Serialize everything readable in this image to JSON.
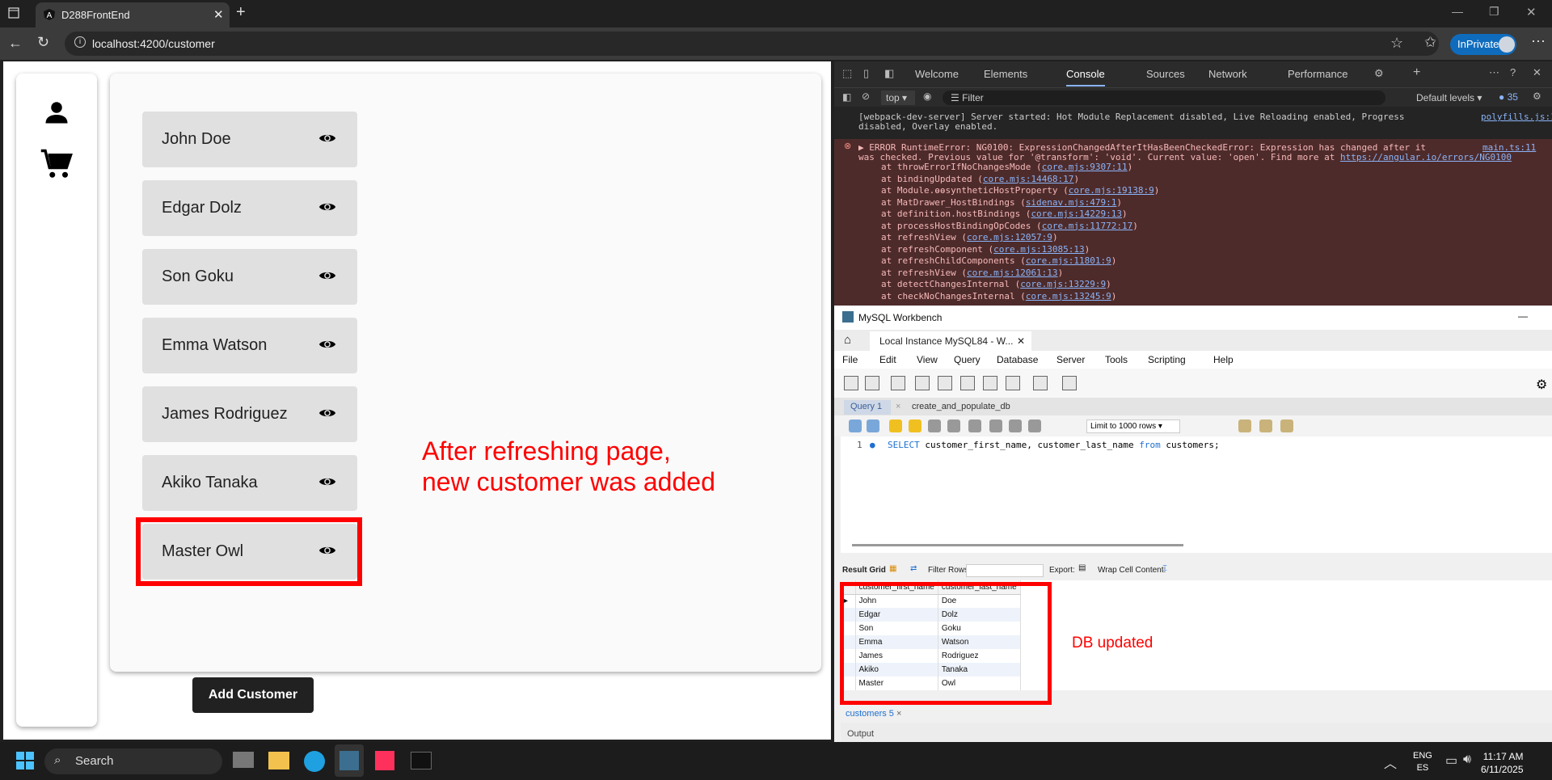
{
  "browser": {
    "tab_title": "D288FrontEnd",
    "url": "localhost:4200/customer",
    "inprivate_label": "InPrivate"
  },
  "app": {
    "customers": [
      {
        "name": "John Doe"
      },
      {
        "name": "Edgar Dolz"
      },
      {
        "name": "Son Goku"
      },
      {
        "name": "Emma Watson"
      },
      {
        "name": "James Rodriguez"
      },
      {
        "name": "Akiko Tanaka"
      },
      {
        "name": "Master Owl"
      }
    ],
    "add_button_label": "Add Customer",
    "annotation": "After refreshing page,\nnew customer was added"
  },
  "devtools": {
    "tabs": [
      "Welcome",
      "Elements",
      "Console",
      "Sources",
      "Network",
      "Performance"
    ],
    "active_tab": "Console",
    "context": "top",
    "filter_placeholder": "Filter",
    "levels": "Default levels",
    "issue_count": "35",
    "info_line_1": "[webpack-dev-server] Server started: Hot Module Replacement disabled, Live Reloading enabled, Progress",
    "info_line_2": "disabled, Overlay enabled.",
    "info_source": "polyfills.js:1",
    "error_line_1": "ERROR RuntimeError: NG0100: ExpressionChangedAfterItHasBeenCheckedError: Expression has changed after it",
    "error_line_2": "was checked. Previous value for '@transform': 'void'. Current value: 'open'. Find more at ",
    "error_link": "https://angular.io/errors/NG0100",
    "error_source": "main.ts:11",
    "stack": [
      {
        "fn": "at throwErrorIfNoChangesMode (",
        "loc": "core.mjs:9307:11"
      },
      {
        "fn": "at bindingUpdated (",
        "loc": "core.mjs:14468:17"
      },
      {
        "fn": "at Module.ɵɵsyntheticHostProperty (",
        "loc": "core.mjs:19138:9"
      },
      {
        "fn": "at MatDrawer_HostBindings (",
        "loc": "sidenav.mjs:479:1"
      },
      {
        "fn": "at definition.hostBindings (",
        "loc": "core.mjs:14229:13"
      },
      {
        "fn": "at processHostBindingOpCodes (",
        "loc": "core.mjs:11772:17"
      },
      {
        "fn": "at refreshView (",
        "loc": "core.mjs:12057:9"
      },
      {
        "fn": "at refreshComponent (",
        "loc": "core.mjs:13085:13"
      },
      {
        "fn": "at refreshChildComponents (",
        "loc": "core.mjs:11801:9"
      },
      {
        "fn": "at refreshView (",
        "loc": "core.mjs:12061:13"
      },
      {
        "fn": "at detectChangesInternal (",
        "loc": "core.mjs:13229:9"
      },
      {
        "fn": "at checkNoChangesInternal (",
        "loc": "core.mjs:13245:9"
      }
    ]
  },
  "workbench": {
    "title": "MySQL Workbench",
    "connection_tab": "Local Instance MySQL84 - W...",
    "menu": [
      "File",
      "Edit",
      "View",
      "Query",
      "Database",
      "Server",
      "Tools",
      "Scripting",
      "Help"
    ],
    "query_tabs": [
      "Query 1",
      "create_and_populate_db"
    ],
    "limit_label": "Limit to 1000 rows",
    "line_number": "1",
    "sql": {
      "kw1": "SELECT",
      "cols": " customer_first_name, customer_last_name ",
      "kw2": "from",
      "rest": " customers;"
    },
    "result_label": "Result Grid",
    "filter_rows_label": "Filter Rows:",
    "export_label": "Export:",
    "wrap_label": "Wrap Cell Content:",
    "columns": [
      "customer_first_name",
      "customer_last_name"
    ],
    "rows": [
      [
        "John",
        "Doe"
      ],
      [
        "Edgar",
        "Dolz"
      ],
      [
        "Son",
        "Goku"
      ],
      [
        "Emma",
        "Watson"
      ],
      [
        "James",
        "Rodriguez"
      ],
      [
        "Akiko",
        "Tanaka"
      ],
      [
        "Master",
        "Owl"
      ]
    ],
    "result_tab": "customers 5",
    "output_label": "Output",
    "annotation": "DB updated"
  },
  "taskbar": {
    "search_placeholder": "Search",
    "lang": "ENG",
    "lang2": "ES",
    "time": "11:17 AM",
    "date": "6/11/2025"
  },
  "colors": {
    "highlight": "#ff0000",
    "accent": "#0f6cbd"
  }
}
